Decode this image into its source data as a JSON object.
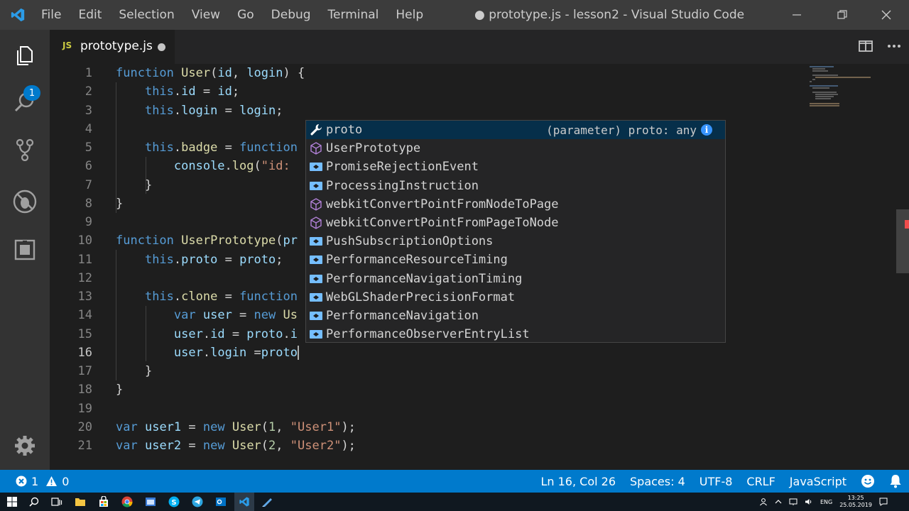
{
  "window": {
    "title": "● prototype.js - lesson2 - Visual Studio Code",
    "menu": [
      "File",
      "Edit",
      "Selection",
      "View",
      "Go",
      "Debug",
      "Terminal",
      "Help"
    ]
  },
  "activity_bar": {
    "explorer_badge": "1"
  },
  "tab": {
    "icon_text": "JS",
    "name": "prototype.js"
  },
  "editor": {
    "line_numbers": [
      "1",
      "2",
      "3",
      "4",
      "5",
      "6",
      "7",
      "8",
      "9",
      "10",
      "11",
      "12",
      "13",
      "14",
      "15",
      "16",
      "17",
      "18",
      "19",
      "20",
      "21"
    ],
    "active_line": "16"
  },
  "suggest": {
    "detail": "(parameter) proto: any",
    "info": "i",
    "items": [
      {
        "kind": "wrench-icon",
        "label": "proto"
      },
      {
        "kind": "cube-icon",
        "label": "UserPrototype"
      },
      {
        "kind": "class-icon",
        "label": "PromiseRejectionEvent"
      },
      {
        "kind": "class-icon",
        "label": "ProcessingInstruction"
      },
      {
        "kind": "cube-icon",
        "label": "webkitConvertPointFromNodeToPage"
      },
      {
        "kind": "cube-icon",
        "label": "webkitConvertPointFromPageToNode"
      },
      {
        "kind": "class-icon",
        "label": "PushSubscriptionOptions"
      },
      {
        "kind": "class-icon",
        "label": "PerformanceResourceTiming"
      },
      {
        "kind": "class-icon",
        "label": "PerformanceNavigationTiming"
      },
      {
        "kind": "class-icon",
        "label": "WebGLShaderPrecisionFormat"
      },
      {
        "kind": "class-icon",
        "label": "PerformanceNavigation"
      },
      {
        "kind": "class-icon",
        "label": "PerformanceObserverEntryList"
      }
    ]
  },
  "statusbar": {
    "errors": "1",
    "warnings": "0",
    "position": "Ln 16, Col 26",
    "spaces": "Spaces: 4",
    "encoding": "UTF-8",
    "eol": "CRLF",
    "language": "JavaScript"
  },
  "taskbar": {
    "lang": "ENG",
    "time": "13:25",
    "date": "25.05.2019"
  },
  "colors": {
    "accent": "#007acc",
    "keyword": "#569cd6",
    "function": "#dcdcaa",
    "string": "#ce9178",
    "match_highlight": "#18a3ff"
  }
}
